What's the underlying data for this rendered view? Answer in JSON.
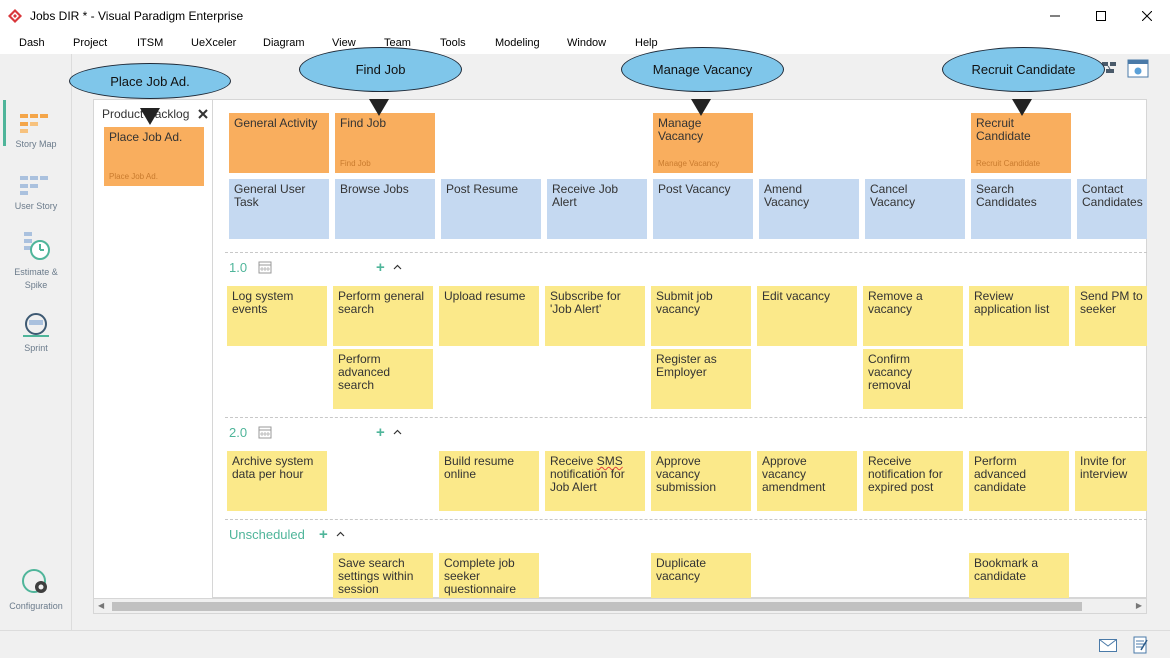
{
  "window": {
    "title": "Jobs DIR * - Visual Paradigm Enterprise"
  },
  "menu": [
    "Dash",
    "Project",
    "ITSM",
    "UeXceler",
    "Diagram",
    "View",
    "Team",
    "Tools",
    "Modeling",
    "Window",
    "Help"
  ],
  "sidebar": {
    "items": [
      {
        "label": "Story Map",
        "icon": "story-map-icon"
      },
      {
        "label": "User Story",
        "icon": "user-story-icon"
      },
      {
        "label": "Estimate & Spike",
        "icon": "estimate-spike-icon"
      },
      {
        "label": "Sprint",
        "icon": "sprint-icon"
      },
      {
        "label": "Configuration",
        "icon": "configuration-icon"
      }
    ]
  },
  "callouts": [
    "Place Job Ad.",
    "Find Job",
    "Manage Vacancy",
    "Recruit Candidate"
  ],
  "backlog": {
    "title": "Product Backlog",
    "card_title": "Place Job Ad.",
    "card_sub": "Place Job Ad."
  },
  "activities": [
    {
      "title": "General Activity",
      "sub": ""
    },
    {
      "title": "Find Job",
      "sub": "Find Job"
    },
    {
      "title": "Manage Vacancy",
      "sub": "Manage Vacancy"
    },
    {
      "title": "Recruit Candidate",
      "sub": "Recruit Candidate"
    }
  ],
  "tasks": [
    "General User Task",
    "Browse Jobs",
    "Post Resume",
    "Receive Job Alert",
    "Post Vacancy",
    "Amend Vacancy",
    "Cancel Vacancy",
    "Search Candidates",
    "Contact Candidates"
  ],
  "releases": [
    {
      "name": "1.0",
      "row1": [
        "Log system events",
        "Perform general search",
        "Upload resume",
        "Subscribe for 'Job Alert'",
        "Submit job vacancy",
        "Edit vacancy",
        "Remove a vacancy",
        "Review application list",
        "Send PM to seeker"
      ],
      "row2": [
        "Perform advanced search",
        "Register as Employer",
        "Confirm vacancy removal"
      ]
    },
    {
      "name": "2.0",
      "row1": [
        "Archive system data per hour",
        "Build resume online",
        "Receive SMS notification for Job Alert",
        "Approve vacancy submission",
        "Approve vacancy amendment",
        "Receive notification for expired post",
        "Perform advanced candidate",
        "Invite for interview"
      ]
    },
    {
      "name": "Unscheduled",
      "row1": [
        "Save search settings within session",
        "Complete job seeker questionnaire",
        "Duplicate vacancy",
        "Bookmark a candidate"
      ]
    }
  ],
  "sms_word": "SMS"
}
